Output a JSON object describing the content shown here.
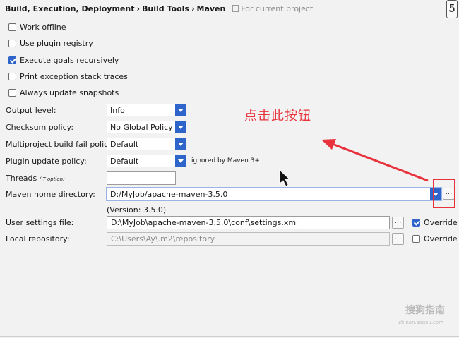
{
  "breadcrumb": {
    "path": [
      "Build, Execution, Deployment",
      "Build Tools",
      "Maven"
    ],
    "separator": "›",
    "project_scope": "For current project"
  },
  "page_marker": "5",
  "checkboxes": [
    {
      "label": "Work offline",
      "checked": false
    },
    {
      "label": "Use plugin registry",
      "checked": false
    },
    {
      "label": "Execute goals recursively",
      "checked": true
    },
    {
      "label": "Print exception stack traces",
      "checked": false
    },
    {
      "label": "Always update snapshots",
      "checked": false
    }
  ],
  "settings": {
    "output_level": {
      "label": "Output level:",
      "value": "Info"
    },
    "checksum_policy": {
      "label": "Checksum policy:",
      "value": "No Global Policy"
    },
    "multiproject_fail_policy": {
      "label": "Multiproject build fail policy:",
      "value": "Default"
    },
    "plugin_update_policy": {
      "label": "Plugin update policy:",
      "value": "Default",
      "note": "ignored by Maven 3+"
    },
    "threads": {
      "label": "Threads",
      "hint": "(-T option)",
      "value": ""
    },
    "maven_home": {
      "label": "Maven home directory:",
      "value": "D:/MyJob/apache-maven-3.5.0",
      "version": "(Version: 3.5.0)"
    },
    "user_settings": {
      "label": "User settings file:",
      "value": "D:\\MyJob\\apache-maven-3.5.0\\conf\\settings.xml",
      "override_label": "Override",
      "override_checked": true
    },
    "local_repository": {
      "label": "Local repository:",
      "value": "C:\\Users\\Ay\\.m2\\repository",
      "override_label": "Override",
      "override_checked": false
    }
  },
  "browse_label": "...",
  "annotation": {
    "text": "点击此按钮",
    "color": "#e8323c"
  },
  "watermark": {
    "text": "搜狗指南",
    "url": "zhinan.sogou.com"
  },
  "colors": {
    "accent": "#2f65ca",
    "annotation": "#e8323c",
    "background": "#f2f2f2"
  }
}
